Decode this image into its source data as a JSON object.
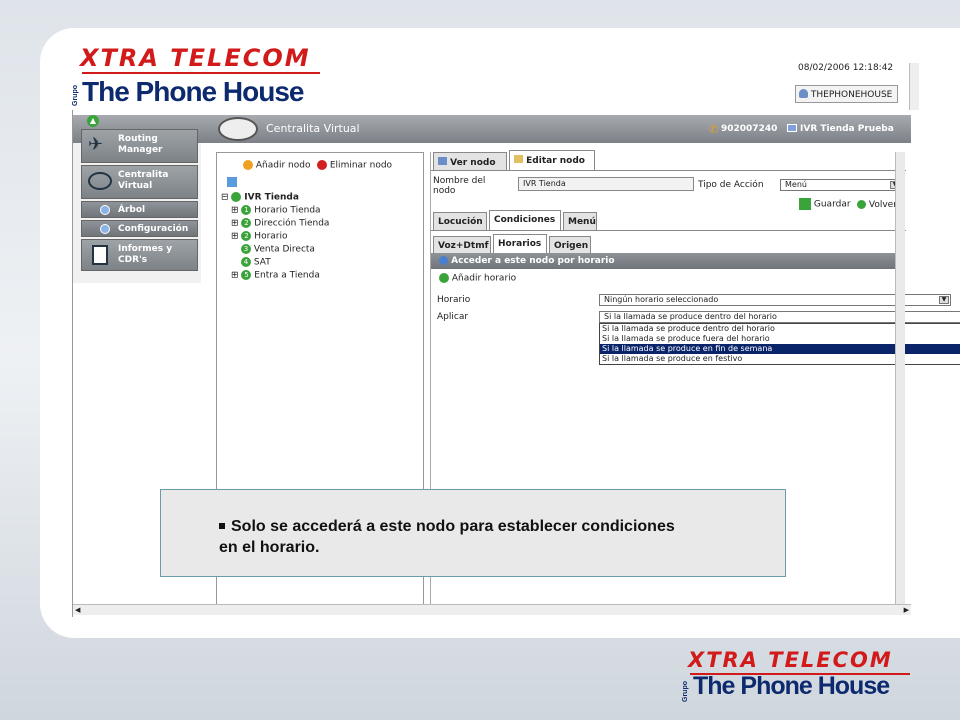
{
  "branding": {
    "xtra_telecom": "XTRA TELECOM",
    "grupo": "Grupo",
    "phone_house": "The Phone House"
  },
  "header": {
    "datetime": "08/02/2006 12:18:42",
    "user_button": "THEPHONEHOUSE"
  },
  "topbar": {
    "title": "Centralita Virtual",
    "phone": "902007240",
    "ivr": "IVR Tienda Prueba"
  },
  "nav": {
    "items": [
      {
        "label": "Routing Manager"
      },
      {
        "label": "Centralita Virtual"
      },
      {
        "label": "Árbol"
      },
      {
        "label": "Configuración"
      },
      {
        "label": "Informes y CDR's"
      }
    ]
  },
  "tree": {
    "add_node": "Añadir nodo",
    "delete_node": "Eliminar nodo",
    "root": "IVR Tienda",
    "children": [
      {
        "num": "1",
        "label": "Horario Tienda"
      },
      {
        "num": "2",
        "label": "Dirección Tienda"
      },
      {
        "num": "2",
        "label": "Horario"
      },
      {
        "num": "3",
        "label": "Venta Directa"
      },
      {
        "num": "4",
        "label": "SAT"
      },
      {
        "num": "5",
        "label": "Entra a Tienda"
      }
    ]
  },
  "editor": {
    "tabs": [
      "Ver nodo",
      "Editar nodo"
    ],
    "node_name_label": "Nombre del nodo",
    "node_name_value": "IVR Tienda",
    "action_type_label": "Tipo de Acción",
    "action_type_value": "Menú",
    "save": "Guardar",
    "back": "Volver",
    "subtabs": [
      "Locución",
      "Condiciones",
      "Menú"
    ],
    "condtabs": [
      "Voz+Dtmf",
      "Horarios",
      "Origen"
    ],
    "section_title": "Acceder a este nodo por horario",
    "add_schedule": "Añadir horario",
    "horario_label": "Horario",
    "horario_value": "Ningún horario seleccionado",
    "aplicar_label": "Aplicar",
    "aplicar_value": "Si la llamada se produce dentro del horario",
    "aplicar_options": [
      "Si la llamada se produce dentro del horario",
      "Si la llamada se produce fuera del horario",
      "Si la llamada se produce en fin de semana",
      "Si la llamada se produce en festivo"
    ],
    "selected_option_index": 2
  },
  "caption": {
    "line1": "Solo se accederá a este nodo para establecer condiciones",
    "line2": "en el horario."
  },
  "colors": {
    "brand_red": "#d21a1a",
    "brand_blue": "#0d2a6e",
    "selection": "#0a246a"
  }
}
